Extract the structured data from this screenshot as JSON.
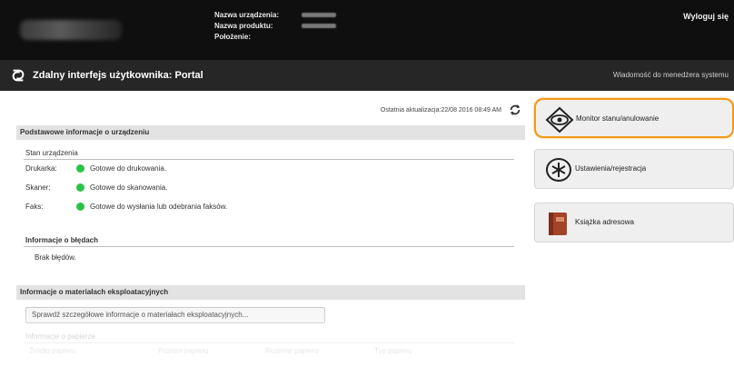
{
  "header": {
    "device_name_label": "Nazwa urządzenia:",
    "product_name_label": "Nazwa produktu:",
    "location_label": "Położenie:",
    "logout_label": "Wyloguj się"
  },
  "titlebar": {
    "title": "Zdalny interfejs użytkownika: Portal",
    "message_to_admin": "Wiadomość do menedżera systemu"
  },
  "main": {
    "last_update": "Ostatnia aktualizacja:22/08 2016 08:49 AM",
    "basic_info": {
      "header": "Podstawowe informacje o urządzeniu",
      "status_heading": "Stan urządzenia",
      "status_rows": [
        {
          "label": "Drukarka:",
          "value": "Gotowe do drukowania."
        },
        {
          "label": "Skaner:",
          "value": "Gotowe do skanowania."
        },
        {
          "label": "Faks:",
          "value": "Gotowe do wysłania lub odebrania faksów."
        }
      ],
      "error_heading": "Informacje o błędach",
      "error_value": "Brak błędów."
    },
    "consumables": {
      "header": "Informacje o materiałach eksploatacyjnych",
      "details_button": "Sprawdź szczegółowe informacje o materiałach eksploatacyjnych...",
      "paper_heading": "Informacje o papierze",
      "columns": [
        "Źródło papieru",
        "Poziom papieru",
        "Rozmiar papieru",
        "Typ papieru"
      ]
    }
  },
  "sidebar": {
    "items": [
      {
        "label": "Monitor stanu/anulowanie",
        "icon": "eye-icon"
      },
      {
        "label": "Ustawienia/rejestracja",
        "icon": "settings-star-icon"
      },
      {
        "label": "Książka adresowa",
        "icon": "address-book-icon"
      }
    ]
  },
  "colors": {
    "status_ok": "#2bc24a",
    "active_highlight": "#f29a16",
    "header_bg": "#0f0f0f"
  }
}
